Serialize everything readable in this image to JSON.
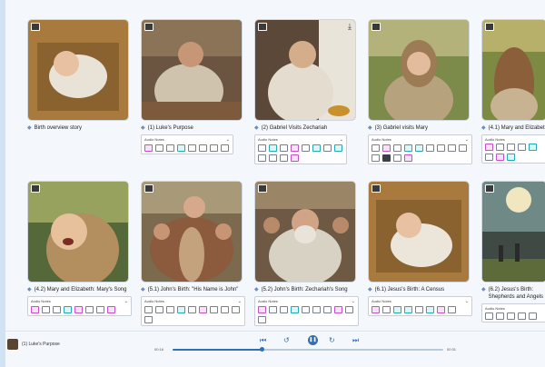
{
  "colors": {
    "accent": "#2f6fb8",
    "page_bg": "#cfe3f5",
    "panel_bg": "#f4f7fb"
  },
  "notes_label": "Audio Notes",
  "cards": [
    {
      "caption": "Birth overview story",
      "notes": false
    },
    {
      "caption": "(1) Luke's Purpose",
      "notes": true
    },
    {
      "caption": "(2) Gabriel Visits Zechariah",
      "notes": true
    },
    {
      "caption": "(3) Gabriel visits Mary",
      "notes": true
    },
    {
      "caption": "(4.1) Mary and Elizabeth",
      "notes": true
    },
    {
      "caption": "(4.2) Mary and Elizabeth: Mary's Song",
      "notes": true
    },
    {
      "caption": "(5.1) John's Birth: \"His Name is John\"",
      "notes": true
    },
    {
      "caption": "(5.2) John's Birth: Zechariah's Song",
      "notes": true
    },
    {
      "caption": "(6.1) Jesus's Birth: A Census",
      "notes": true
    },
    {
      "caption": "(6.2) Jesus's Birth: Shepherds and Angels",
      "notes": true
    }
  ],
  "player": {
    "now_playing": "(1) Luke's Purpose",
    "elapsed": "00:16",
    "duration": "00:31",
    "progress": 0.33
  }
}
